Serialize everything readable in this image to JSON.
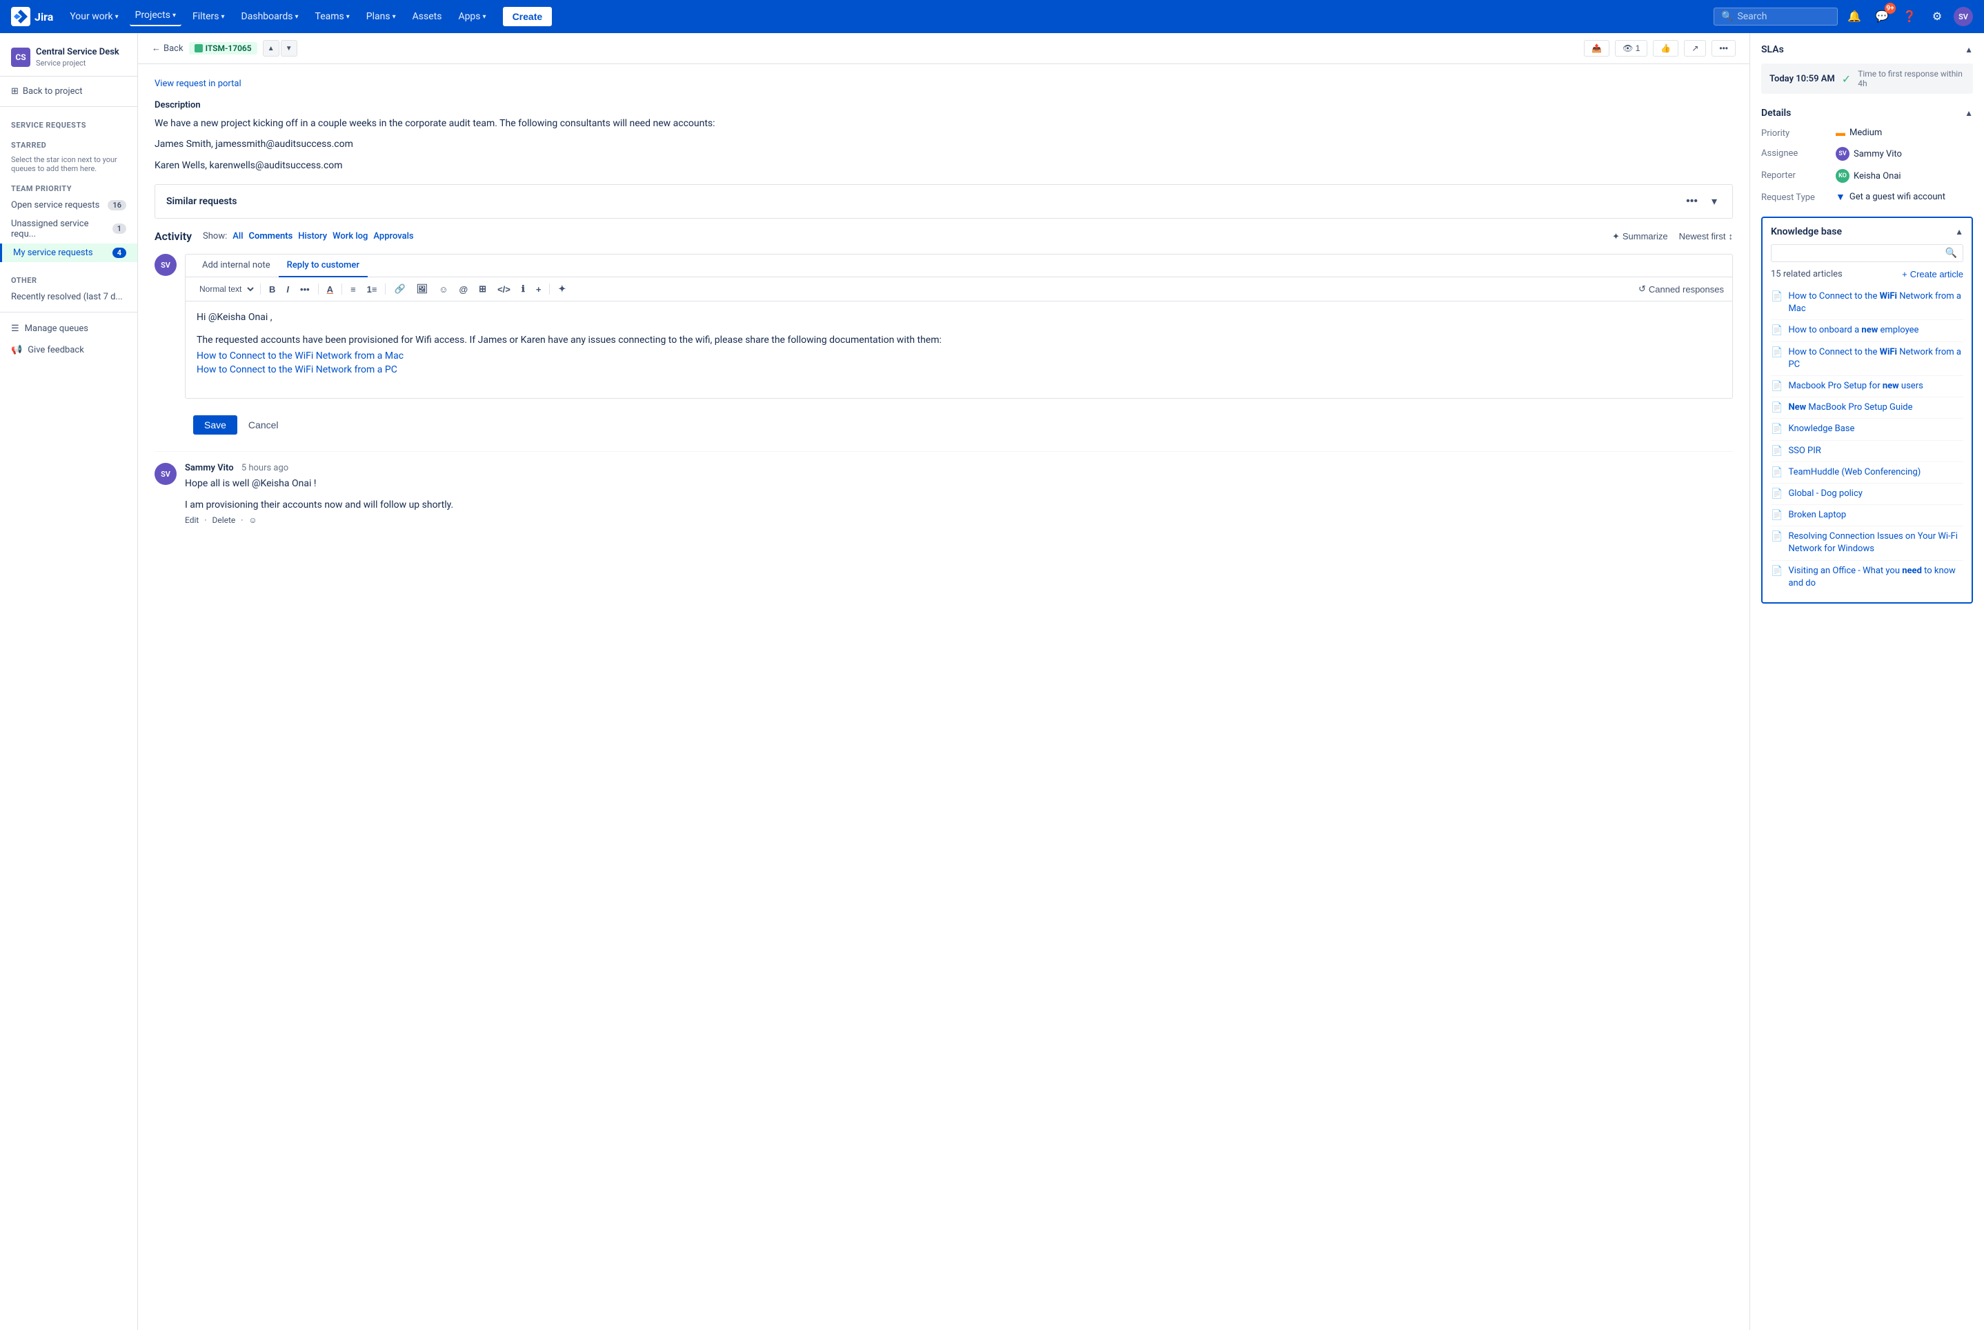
{
  "topNav": {
    "logo_text": "Jira",
    "your_work": "Your work",
    "projects": "Projects",
    "filters": "Filters",
    "dashboards": "Dashboards",
    "teams": "Teams",
    "plans": "Plans",
    "assets": "Assets",
    "apps": "Apps",
    "create": "Create",
    "search_placeholder": "Search",
    "notification_count": "9+"
  },
  "sidebar": {
    "project_name": "Central Service Desk",
    "project_type": "Service project",
    "project_initials": "CS",
    "back_to_project": "Back to project",
    "service_requests_label": "Service requests",
    "starred_label": "STARRED",
    "starred_empty": "Select the star icon next to your queues to add them here.",
    "team_priority_label": "TEAM PRIORITY",
    "queue_items": [
      {
        "label": "Open service requests",
        "count": "16"
      },
      {
        "label": "Unassigned service requ...",
        "count": "1"
      },
      {
        "label": "My service requests",
        "count": "4"
      }
    ],
    "other_label": "OTHER",
    "other_items": [
      {
        "label": "Recently resolved (last 7 d..."
      }
    ],
    "manage_queues": "Manage queues",
    "give_feedback": "Give feedback"
  },
  "issueBreadcrumb": {
    "back": "Back",
    "issue_key": "ITSM-17065",
    "issue_key_color": "#006644"
  },
  "issueHeader": {
    "view_portal": "View request in portal",
    "description_label": "Description",
    "description_text": "We have a new project kicking off in a couple weeks in the corporate audit team. The following consultants will need new accounts:",
    "contacts": [
      "James Smith, jamessmith@auditsuccess.com",
      "Karen Wells, karenwells@auditsuccess.com"
    ]
  },
  "similarRequests": {
    "title": "Similar requests"
  },
  "activity": {
    "title": "Activity",
    "show_label": "Show:",
    "filters": [
      "All",
      "Comments",
      "History",
      "Work log",
      "Approvals"
    ],
    "active_filter": "Comments",
    "summarize": "Summarize",
    "newest_first": "Newest first"
  },
  "commentEditor": {
    "tabs": [
      {
        "label": "Add internal note",
        "active": false
      },
      {
        "label": "Reply to customer",
        "active": true
      }
    ],
    "toolbar": {
      "text_style": "Normal text",
      "bold": "B",
      "italic": "I",
      "more": "...",
      "text_color": "A",
      "bullet_list": "•≡",
      "numbered_list": "1≡",
      "link": "🔗",
      "image": "🖼",
      "emoji": "☺",
      "mention": "@",
      "table": "⊞",
      "code": "</>",
      "info": "ℹ",
      "more2": "+",
      "ai": "✦",
      "canned": "Canned responses"
    },
    "content": {
      "greeting": "Hi @Keisha Onai ,",
      "body": "The requested accounts have been provisioned for Wifi access. If James or Karen have any issues connecting to the wifi, please share the following documentation with them:",
      "links": [
        "How to Connect to the WiFi Network from a Mac",
        "How to Connect to the WiFi Network from a PC"
      ]
    },
    "save_btn": "Save",
    "cancel_btn": "Cancel"
  },
  "previousComment": {
    "author": "Sammy Vito",
    "time": "5 hours ago",
    "initials": "SV",
    "text1": "Hope all is well @Keisha Onai !",
    "text2": "I am provisioning their accounts now and will follow up shortly.",
    "actions": [
      "Edit",
      "Delete"
    ]
  },
  "rightPanel": {
    "slas_title": "SLAs",
    "sla_item": {
      "time": "Today 10:59 AM",
      "desc": "Time to first response within 4h"
    },
    "details_title": "Details",
    "priority_label": "Priority",
    "priority_value": "Medium",
    "assignee_label": "Assignee",
    "assignee": "Sammy Vito",
    "assignee_initials": "SV",
    "reporter_label": "Reporter",
    "reporter": "Keisha Onai",
    "reporter_initials": "KO",
    "request_type_label": "Request Type",
    "request_type": "Get a guest wifi account",
    "kb_title": "Knowledge base",
    "kb_count": "15 related articles",
    "create_article": "Create article",
    "articles": [
      {
        "title": "How to Connect to the ",
        "bold": "WiFi",
        "rest": " Network from a Mac"
      },
      {
        "title": "How to onboard a ",
        "bold": "new",
        "rest": " employee"
      },
      {
        "title": "How to Connect to the ",
        "bold": "WiFi",
        "rest": " Network from a PC"
      },
      {
        "title": "Macbook Pro Setup for ",
        "bold": "new",
        "rest": " users"
      },
      {
        "title": "",
        "bold": "New",
        "rest": " MacBook Pro Setup Guide"
      },
      {
        "title": "Knowledge Base",
        "bold": "",
        "rest": ""
      },
      {
        "title": "SSO PIR",
        "bold": "",
        "rest": ""
      },
      {
        "title": "TeamHuddle (Web Conferencing)",
        "bold": "",
        "rest": ""
      },
      {
        "title": "Global - Dog policy",
        "bold": "",
        "rest": ""
      },
      {
        "title": "Broken Laptop",
        "bold": "",
        "rest": ""
      },
      {
        "title": "Resolving Connection Issues on Your Wi-Fi Network for Windows",
        "bold": "",
        "rest": ""
      },
      {
        "title": "Visiting an Office - What you ",
        "bold": "need",
        "rest": " to know and do"
      }
    ]
  }
}
